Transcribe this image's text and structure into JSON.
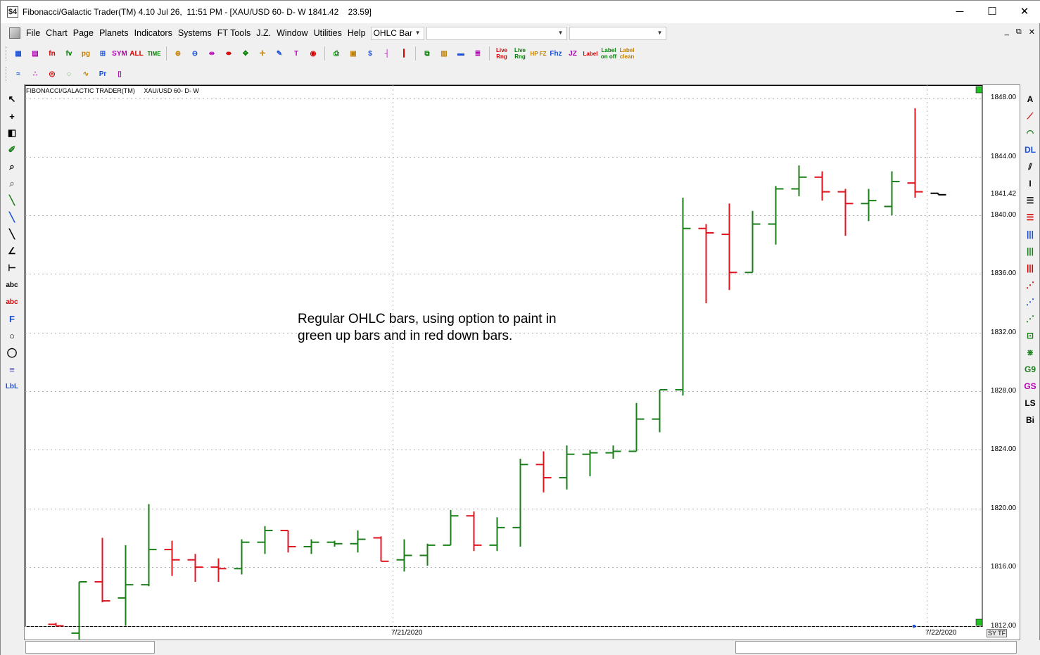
{
  "window": {
    "title": "Fibonacci/Galactic Trader(TM) 4.10 Jul 26,  11:51 PM - [XAU/USD 60- D- W 1841.42    23.59]",
    "app_icon_glyph": "$4",
    "minimize_glyph": "─",
    "maximize_glyph": "☐",
    "close_glyph": "✕"
  },
  "menu": {
    "items": [
      "File",
      "Chart",
      "Page",
      "Planets",
      "Indicators",
      "Systems",
      "FT Tools",
      "J.Z.",
      "Window",
      "Utilities",
      "Help"
    ],
    "chart_type_combo": "OHLC Bar",
    "mdi_controls": [
      "_",
      "⧉",
      "✕"
    ]
  },
  "toolbar1": {
    "buttons": [
      {
        "icon": "chart-open-icon",
        "label": "▦"
      },
      {
        "icon": "chart-list-icon",
        "label": "▤"
      },
      {
        "icon": "fn-icon",
        "label": "fn"
      },
      {
        "icon": "fv-icon",
        "label": "fv"
      },
      {
        "icon": "pg-icon",
        "label": "pg"
      },
      {
        "icon": "grid-icon",
        "label": "⊞"
      },
      {
        "icon": "sym-icon",
        "label": "SYM"
      },
      {
        "icon": "all-icon",
        "label": "ALL"
      },
      {
        "icon": "time-icon",
        "label": "TIME"
      },
      {
        "icon": "zoom-in-icon",
        "label": "⊕"
      },
      {
        "icon": "zoom-out-icon",
        "label": "⊖"
      },
      {
        "icon": "expand-icon",
        "label": "⇹"
      },
      {
        "icon": "compress-icon",
        "label": "⇼"
      },
      {
        "icon": "move-icon",
        "label": "✥"
      },
      {
        "icon": "cross-icon",
        "label": "✛"
      },
      {
        "icon": "pen-icon",
        "label": "✎"
      },
      {
        "icon": "text-icon",
        "label": "T"
      },
      {
        "icon": "traffic-icon",
        "label": "◉"
      },
      {
        "icon": "print-icon",
        "label": "⎙"
      },
      {
        "icon": "calc-icon",
        "label": "▣"
      },
      {
        "icon": "dollar-icon",
        "label": "$"
      },
      {
        "icon": "bars-icon",
        "label": "┤"
      },
      {
        "icon": "candles-icon",
        "label": "┃"
      },
      {
        "icon": "windows-icon",
        "label": "⧉"
      },
      {
        "icon": "stack-icon",
        "label": "▥"
      },
      {
        "icon": "red-stack-icon",
        "label": "▬"
      },
      {
        "icon": "color-bars-icon",
        "label": "≣"
      },
      {
        "icon": "live-rng-1-icon",
        "label": "Live Rng"
      },
      {
        "icon": "live-rng-2-icon",
        "label": "Live Rng"
      },
      {
        "icon": "hp-fz-icon",
        "label": "HP FZ"
      },
      {
        "icon": "fhz-icon",
        "label": "Fhz"
      },
      {
        "icon": "jz-icon",
        "label": "JZ"
      },
      {
        "icon": "label-icon",
        "label": "Label"
      },
      {
        "icon": "label-onoff-icon",
        "label": "Label on off"
      },
      {
        "icon": "label-clean-icon",
        "label": "Label clean"
      }
    ]
  },
  "toolbar2": {
    "buttons": [
      {
        "icon": "wave-icon",
        "label": "≈"
      },
      {
        "icon": "planets-icon",
        "label": "∴"
      },
      {
        "icon": "target-icon",
        "label": "◎"
      },
      {
        "icon": "orbit-icon",
        "label": "◌"
      },
      {
        "icon": "cycles-icon",
        "label": "∿"
      },
      {
        "icon": "pr-icon",
        "label": "Pr"
      },
      {
        "icon": "page-icon",
        "label": "▯"
      }
    ]
  },
  "left_tools": [
    {
      "icon": "pointer-icon",
      "glyph": "↖"
    },
    {
      "icon": "crosshair-icon",
      "glyph": "+"
    },
    {
      "icon": "magnet-icon",
      "glyph": "◧"
    },
    {
      "icon": "eraser-icon",
      "glyph": "✐"
    },
    {
      "icon": "zoom-icon",
      "glyph": "⌕"
    },
    {
      "icon": "zoom-gray-icon",
      "glyph": "⌕"
    },
    {
      "icon": "green-line-icon",
      "glyph": "╲"
    },
    {
      "icon": "blue-line-icon",
      "glyph": "╲"
    },
    {
      "icon": "ray-icon",
      "glyph": "╲"
    },
    {
      "icon": "angle-icon",
      "glyph": "∠"
    },
    {
      "icon": "fork-icon",
      "glyph": "⊢"
    },
    {
      "icon": "text-abc-icon",
      "glyph": "abc"
    },
    {
      "icon": "text-delete-icon",
      "glyph": "abc"
    },
    {
      "icon": "fib-f-icon",
      "glyph": "F"
    },
    {
      "icon": "circle-icon",
      "glyph": "○"
    },
    {
      "icon": "ellipse-icon",
      "glyph": "◯"
    },
    {
      "icon": "lines-icon",
      "glyph": "≡"
    },
    {
      "icon": "lbl-icon",
      "glyph": "LbL"
    }
  ],
  "right_tools": [
    {
      "icon": "text-a-icon",
      "glyph": "A"
    },
    {
      "icon": "fan-icon",
      "glyph": "⟋"
    },
    {
      "icon": "arc-icon",
      "glyph": "◠"
    },
    {
      "icon": "dl-icon",
      "glyph": "DL"
    },
    {
      "icon": "parallel-icon",
      "glyph": "⫽"
    },
    {
      "icon": "retrace-icon",
      "glyph": "I"
    },
    {
      "icon": "levels-icon",
      "glyph": "☰"
    },
    {
      "icon": "levels-red-icon",
      "glyph": "☰"
    },
    {
      "icon": "vlines-blue-icon",
      "glyph": "|||"
    },
    {
      "icon": "vlines-green-icon",
      "glyph": "|||"
    },
    {
      "icon": "vlines-red-icon",
      "glyph": "|||"
    },
    {
      "icon": "speed-icon",
      "glyph": "⋰"
    },
    {
      "icon": "speed-blue-icon",
      "glyph": "⋰"
    },
    {
      "icon": "speed-green-icon",
      "glyph": "⋰"
    },
    {
      "icon": "gann-box-icon",
      "glyph": "⊡"
    },
    {
      "icon": "gann-fan-icon",
      "glyph": "⋇"
    },
    {
      "icon": "g9-icon",
      "glyph": "G9"
    },
    {
      "icon": "gs-icon",
      "glyph": "GS"
    },
    {
      "icon": "ls-icon",
      "glyph": "LS"
    },
    {
      "icon": "bi-icon",
      "glyph": "Bi"
    }
  ],
  "chart": {
    "header": "FIBONACCI/GALACTIC TRADER(TM)     XAU/USD 60- D- W",
    "annotation_line1": "Regular OHLC bars, using option to paint in",
    "annotation_line2": "green up bars and in red down bars.",
    "last_price_label": "1841.42",
    "sytf_label": "SY TF",
    "colors": {
      "up": "#1a7f1a",
      "down": "#e0141e",
      "last": "#000000",
      "grid": "#b0b0b0",
      "marker": "#22c022"
    }
  },
  "chart_data": {
    "type": "bar",
    "symbol": "XAU/USD",
    "ylim": [
      1812,
      1850
    ],
    "yticks": [
      1848,
      1844,
      1840,
      1836,
      1832,
      1828,
      1824,
      1820,
      1816,
      1812
    ],
    "ytick_labels": [
      "1848.00",
      "1844.00",
      "1840.00",
      "1836.00",
      "1832.00",
      "1828.00",
      "1824.00",
      "1820.00",
      "1816.00",
      "1812.00"
    ],
    "xlabels": [
      {
        "label": "7/21/2020",
        "bar": 15
      },
      {
        "label": "7/22/2020",
        "bar": 38
      }
    ],
    "bars": [
      {
        "o": 1812.1,
        "h": 1812.2,
        "l": 1812.0,
        "c": 1812.0,
        "dir": "down"
      },
      {
        "o": 1811.5,
        "h": 1815.0,
        "l": 1811.0,
        "c": 1815.0,
        "dir": "up"
      },
      {
        "o": 1815.0,
        "h": 1818.0,
        "l": 1813.6,
        "c": 1813.7,
        "dir": "down"
      },
      {
        "o": 1813.9,
        "h": 1817.5,
        "l": 1812.0,
        "c": 1814.8,
        "dir": "up"
      },
      {
        "o": 1814.8,
        "h": 1820.3,
        "l": 1814.7,
        "c": 1817.2,
        "dir": "up"
      },
      {
        "o": 1817.2,
        "h": 1817.8,
        "l": 1815.4,
        "c": 1816.5,
        "dir": "down"
      },
      {
        "o": 1816.5,
        "h": 1816.9,
        "l": 1815.0,
        "c": 1816.0,
        "dir": "down"
      },
      {
        "o": 1816.0,
        "h": 1816.6,
        "l": 1815.0,
        "c": 1815.9,
        "dir": "down"
      },
      {
        "o": 1815.9,
        "h": 1817.9,
        "l": 1815.5,
        "c": 1817.7,
        "dir": "up"
      },
      {
        "o": 1817.7,
        "h": 1818.8,
        "l": 1816.9,
        "c": 1818.5,
        "dir": "up"
      },
      {
        "o": 1818.5,
        "h": 1818.5,
        "l": 1817.0,
        "c": 1817.4,
        "dir": "down"
      },
      {
        "o": 1817.4,
        "h": 1817.9,
        "l": 1816.9,
        "c": 1817.7,
        "dir": "up"
      },
      {
        "o": 1817.7,
        "h": 1817.8,
        "l": 1817.4,
        "c": 1817.6,
        "dir": "up"
      },
      {
        "o": 1817.6,
        "h": 1818.5,
        "l": 1817.0,
        "c": 1817.9,
        "dir": "up"
      },
      {
        "o": 1818.0,
        "h": 1818.1,
        "l": 1816.4,
        "c": 1816.4,
        "dir": "down"
      },
      {
        "o": 1816.5,
        "h": 1817.9,
        "l": 1815.7,
        "c": 1816.8,
        "dir": "up"
      },
      {
        "o": 1816.8,
        "h": 1817.6,
        "l": 1816.1,
        "c": 1817.5,
        "dir": "up"
      },
      {
        "o": 1817.5,
        "h": 1819.9,
        "l": 1817.5,
        "c": 1819.5,
        "dir": "up"
      },
      {
        "o": 1819.5,
        "h": 1819.8,
        "l": 1817.1,
        "c": 1817.5,
        "dir": "down"
      },
      {
        "o": 1817.5,
        "h": 1819.4,
        "l": 1817.1,
        "c": 1818.7,
        "dir": "up"
      },
      {
        "o": 1818.7,
        "h": 1823.4,
        "l": 1817.4,
        "c": 1823.0,
        "dir": "up"
      },
      {
        "o": 1823.0,
        "h": 1823.9,
        "l": 1821.1,
        "c": 1822.1,
        "dir": "down"
      },
      {
        "o": 1822.1,
        "h": 1824.3,
        "l": 1821.3,
        "c": 1823.7,
        "dir": "up"
      },
      {
        "o": 1823.7,
        "h": 1824.0,
        "l": 1822.2,
        "c": 1823.8,
        "dir": "up"
      },
      {
        "o": 1823.8,
        "h": 1824.3,
        "l": 1823.4,
        "c": 1823.9,
        "dir": "up"
      },
      {
        "o": 1823.9,
        "h": 1827.2,
        "l": 1823.9,
        "c": 1826.1,
        "dir": "up"
      },
      {
        "o": 1826.1,
        "h": 1828.1,
        "l": 1825.2,
        "c": 1828.1,
        "dir": "up"
      },
      {
        "o": 1828.1,
        "h": 1841.2,
        "l": 1827.7,
        "c": 1839.1,
        "dir": "up"
      },
      {
        "o": 1839.1,
        "h": 1839.4,
        "l": 1834.0,
        "c": 1838.8,
        "dir": "down"
      },
      {
        "o": 1838.7,
        "h": 1840.8,
        "l": 1834.9,
        "c": 1836.1,
        "dir": "down"
      },
      {
        "o": 1836.1,
        "h": 1840.3,
        "l": 1836.1,
        "c": 1839.4,
        "dir": "up"
      },
      {
        "o": 1839.4,
        "h": 1842.0,
        "l": 1838.0,
        "c": 1841.8,
        "dir": "up"
      },
      {
        "o": 1841.8,
        "h": 1843.4,
        "l": 1841.3,
        "c": 1842.6,
        "dir": "up"
      },
      {
        "o": 1842.6,
        "h": 1843.0,
        "l": 1841.0,
        "c": 1841.6,
        "dir": "down"
      },
      {
        "o": 1841.6,
        "h": 1841.8,
        "l": 1838.6,
        "c": 1840.8,
        "dir": "down"
      },
      {
        "o": 1840.8,
        "h": 1841.8,
        "l": 1839.6,
        "c": 1841.0,
        "dir": "up"
      },
      {
        "o": 1840.6,
        "h": 1843.0,
        "l": 1840.0,
        "c": 1842.3,
        "dir": "up"
      },
      {
        "o": 1842.2,
        "h": 1847.3,
        "l": 1841.2,
        "c": 1841.6,
        "dir": "down"
      },
      {
        "o": 1841.5,
        "h": 1841.5,
        "l": 1841.4,
        "c": 1841.4,
        "dir": "last"
      }
    ]
  }
}
